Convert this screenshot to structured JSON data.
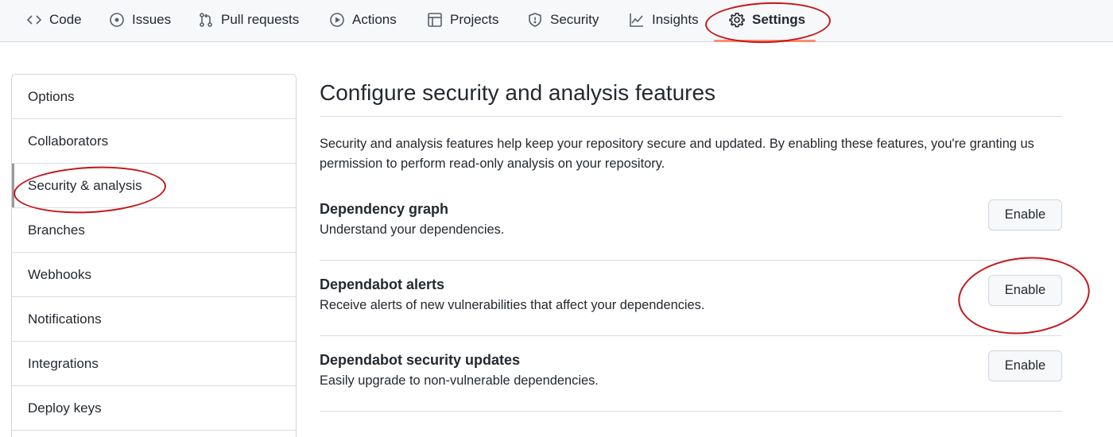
{
  "tabs": [
    {
      "label": "Code",
      "icon": "code-icon"
    },
    {
      "label": "Issues",
      "icon": "issue-icon"
    },
    {
      "label": "Pull requests",
      "icon": "pull-request-icon"
    },
    {
      "label": "Actions",
      "icon": "play-icon"
    },
    {
      "label": "Projects",
      "icon": "table-icon"
    },
    {
      "label": "Security",
      "icon": "shield-icon"
    },
    {
      "label": "Insights",
      "icon": "graph-icon"
    },
    {
      "label": "Settings",
      "icon": "gear-icon",
      "selected": true
    }
  ],
  "sidebar": {
    "items": [
      {
        "label": "Options"
      },
      {
        "label": "Collaborators"
      },
      {
        "label": "Security & analysis",
        "active": true
      },
      {
        "label": "Branches"
      },
      {
        "label": "Webhooks"
      },
      {
        "label": "Notifications"
      },
      {
        "label": "Integrations"
      },
      {
        "label": "Deploy keys"
      }
    ]
  },
  "main": {
    "title": "Configure security and analysis features",
    "intro_line1": "Security and analysis features help keep your repository secure and updated. By enabling these features, you're granting us",
    "intro_line2": "permission to perform read-only analysis on your repository.",
    "features": [
      {
        "title": "Dependency graph",
        "description": "Understand your dependencies.",
        "button": "Enable"
      },
      {
        "title": "Dependabot alerts",
        "description": "Receive alerts of new vulnerabilities that affect your dependencies.",
        "button": "Enable"
      },
      {
        "title": "Dependabot security updates",
        "description": "Easily upgrade to non-vulnerable dependencies.",
        "button": "Enable"
      }
    ]
  },
  "colors": {
    "selected_underline": "#fd8c73",
    "annotation_red": "#c4161c",
    "border": "#d0d7de"
  }
}
